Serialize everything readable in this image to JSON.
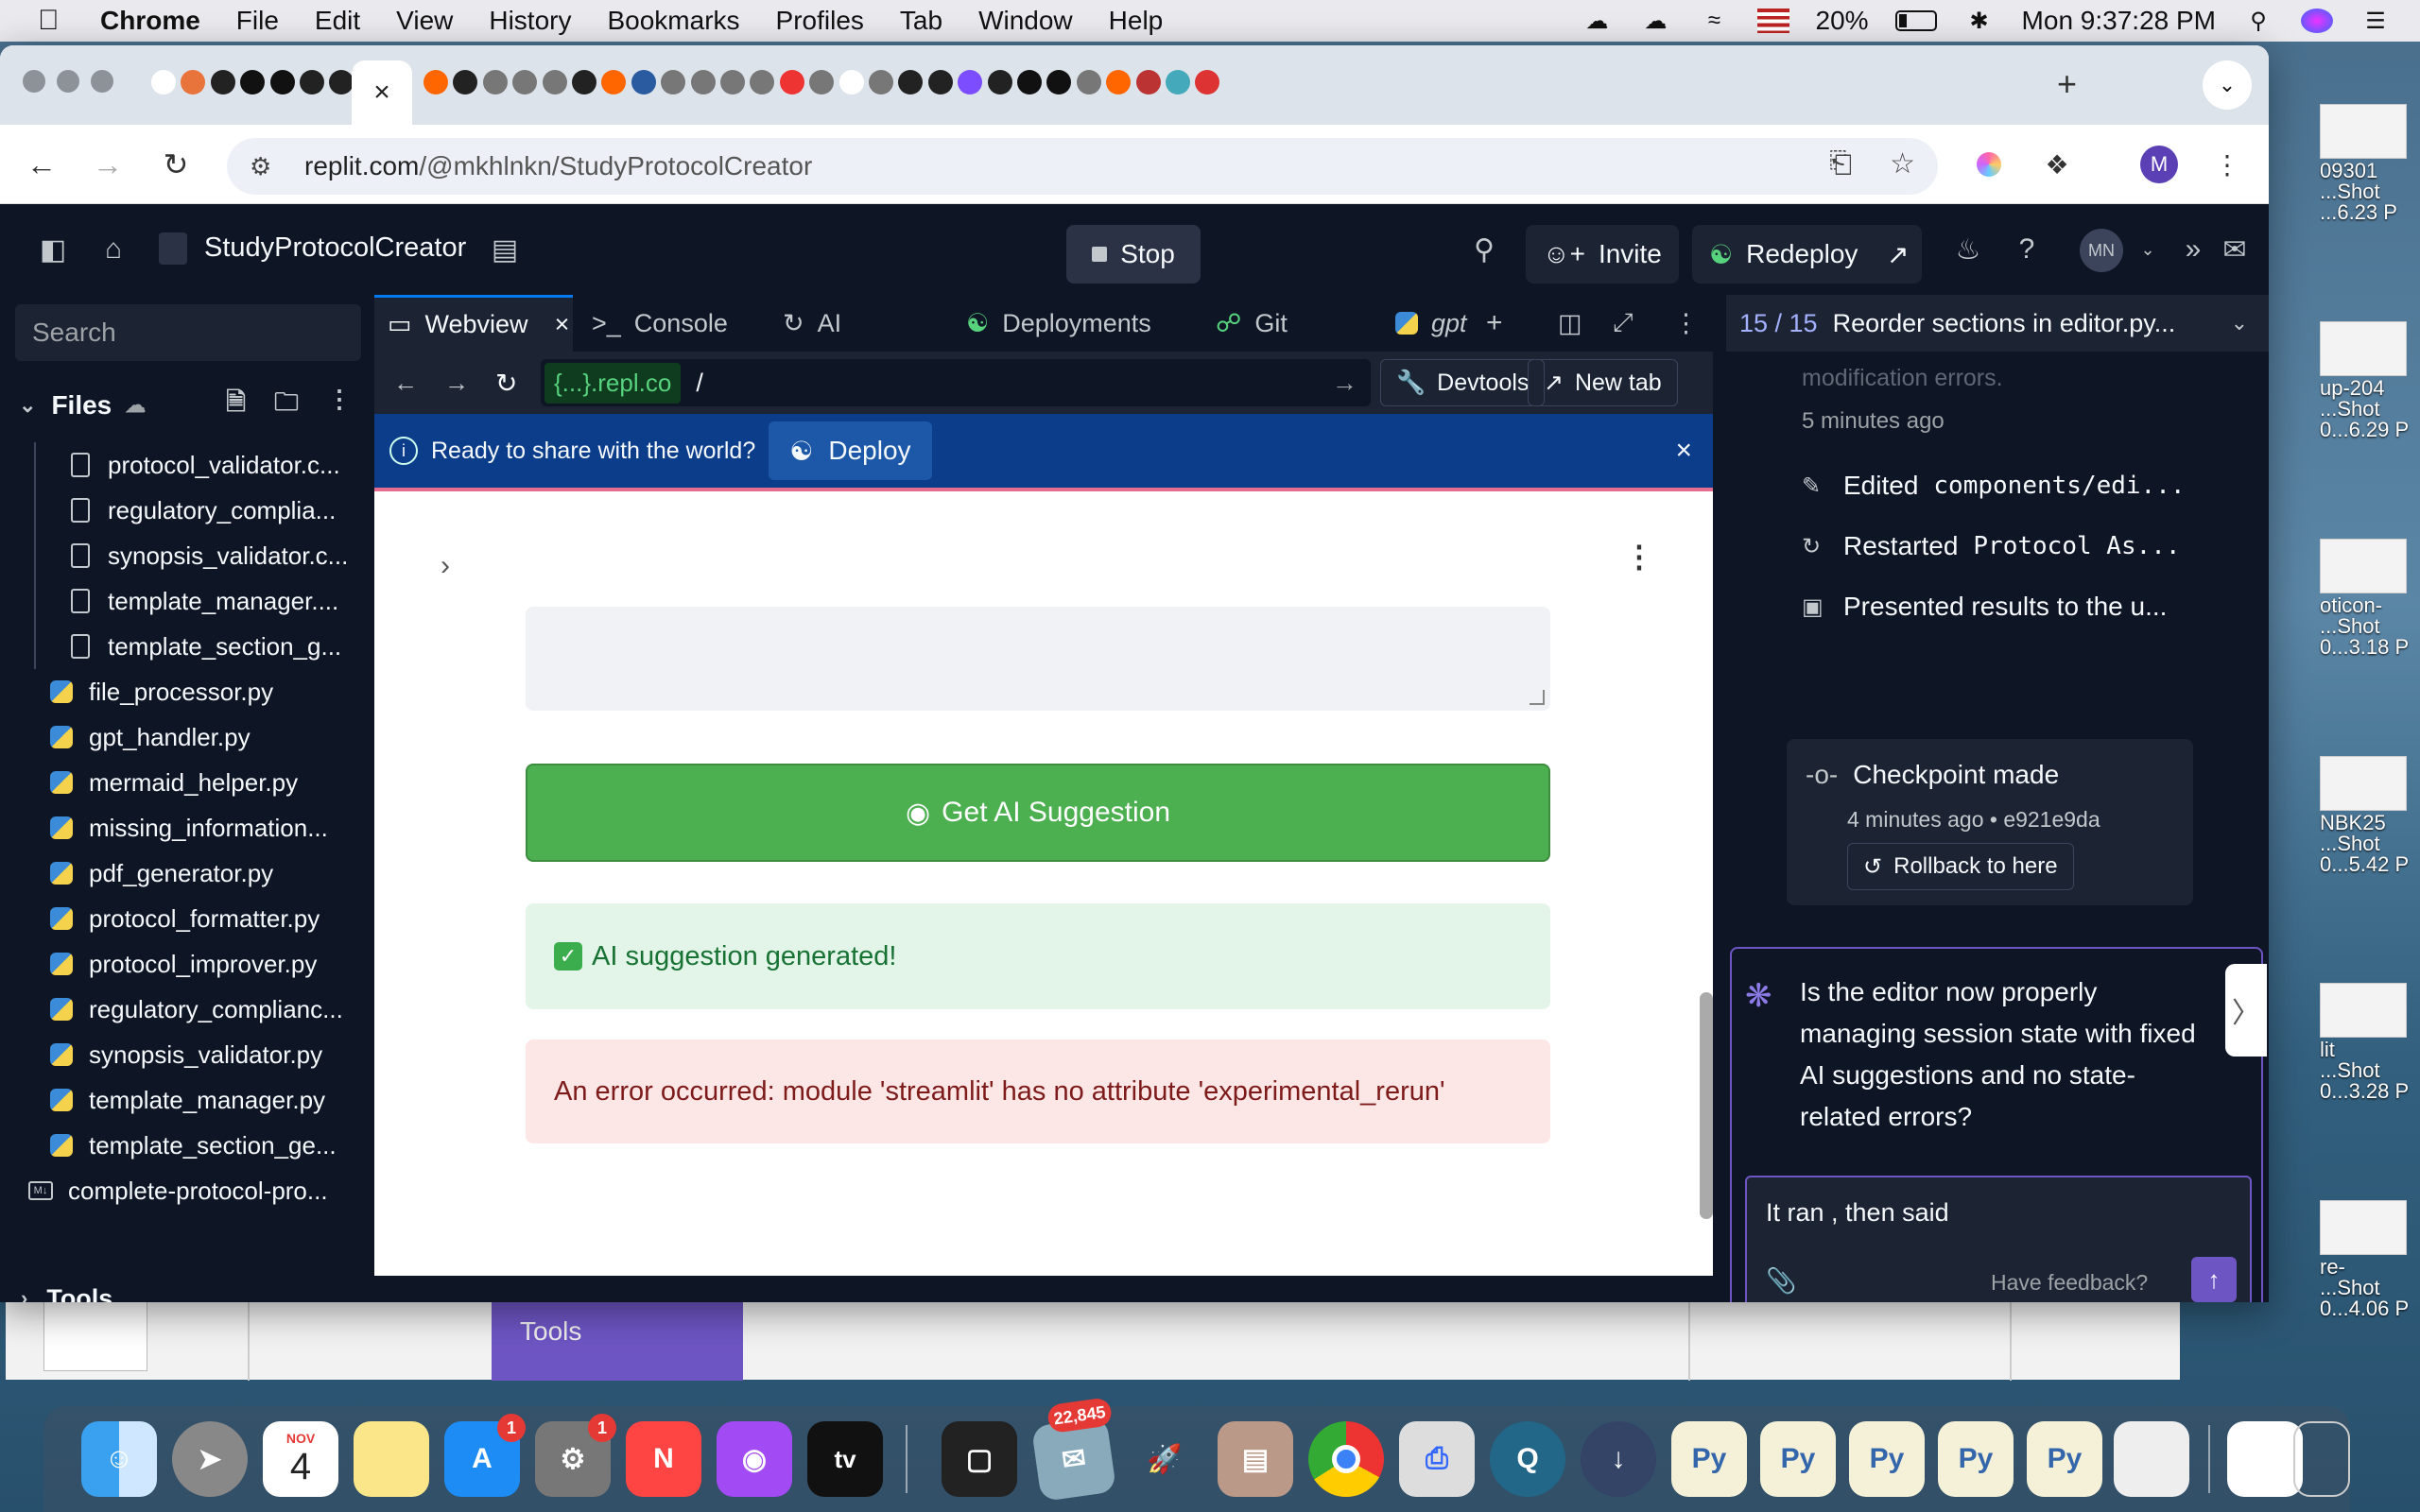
{
  "menubar": {
    "app": "Chrome",
    "items": [
      "File",
      "Edit",
      "View",
      "History",
      "Bookmarks",
      "Profiles",
      "Tab",
      "Window",
      "Help"
    ],
    "battery": "20%",
    "clock": "Mon 9:37:28 PM"
  },
  "chrome": {
    "url_host": "replit.com",
    "url_path": "/@mkhlnkn/StudyProtocolCreator",
    "profile_initial": "M",
    "active_tab_close": "×",
    "new_tab": "+"
  },
  "replit": {
    "project_title": "StudyProtocolCreator",
    "stop_label": "Stop",
    "invite_label": "Invite",
    "redeploy_label": "Redeploy",
    "avatar_initials": "MN",
    "sidebar": {
      "search_placeholder": "Search",
      "files_label": "Files",
      "files": [
        {
          "name": "protocol_validator.c...",
          "type": "doc",
          "indent": 2
        },
        {
          "name": "regulatory_complia...",
          "type": "doc",
          "indent": 2
        },
        {
          "name": "synopsis_validator.c...",
          "type": "doc",
          "indent": 2
        },
        {
          "name": "template_manager....",
          "type": "doc",
          "indent": 2
        },
        {
          "name": "template_section_g...",
          "type": "doc",
          "indent": 2
        },
        {
          "name": "file_processor.py",
          "type": "py",
          "indent": 1
        },
        {
          "name": "gpt_handler.py",
          "type": "py",
          "indent": 1
        },
        {
          "name": "mermaid_helper.py",
          "type": "py",
          "indent": 1
        },
        {
          "name": "missing_information...",
          "type": "py",
          "indent": 1
        },
        {
          "name": "pdf_generator.py",
          "type": "py",
          "indent": 1
        },
        {
          "name": "protocol_formatter.py",
          "type": "py",
          "indent": 1
        },
        {
          "name": "protocol_improver.py",
          "type": "py",
          "indent": 1
        },
        {
          "name": "regulatory_complianc...",
          "type": "py",
          "indent": 1
        },
        {
          "name": "synopsis_validator.py",
          "type": "py",
          "indent": 1
        },
        {
          "name": "template_manager.py",
          "type": "py",
          "indent": 1
        },
        {
          "name": "template_section_ge...",
          "type": "py",
          "indent": 1
        },
        {
          "name": "complete-protocol-pro...",
          "type": "md",
          "indent": 0
        }
      ],
      "tools_label": "Tools"
    },
    "tabs": {
      "webview": "Webview",
      "console": "Console",
      "ai": "AI",
      "deployments": "Deployments",
      "git": "Git",
      "gpt": "gpt"
    },
    "urlbar": {
      "chip": "{...}.repl.co",
      "path": "/",
      "devtools": "Devtools",
      "new_tab": "New tab"
    },
    "banner": {
      "text": "Ready to share with the world?",
      "deploy": "Deploy"
    },
    "webview": {
      "ai_button": "Get AI Suggestion",
      "success": "AI suggestion generated!",
      "error": "An error occurred: module 'streamlit' has no attribute 'experimental_rerun'"
    },
    "agent": {
      "counter": "15 / 15",
      "task_title": "Reorder sections in editor.py...",
      "faded_text": "modification errors.",
      "time_ago": "5 minutes ago",
      "actions": [
        {
          "prefix": "Edited",
          "mono": "components/edi..."
        },
        {
          "prefix": "Restarted",
          "mono": "Protocol As..."
        },
        {
          "prefix": "Presented results to the u...",
          "mono": ""
        }
      ],
      "checkpoint_title": "Checkpoint made",
      "checkpoint_meta": "4 minutes ago • e921e9da",
      "rollback": "Rollback to here",
      "question": "Is the editor now properly managing session state with fixed AI suggestions and no state-related errors?",
      "reply_text": "It ran , then said",
      "feedback": "Have feedback?"
    }
  },
  "backwindow": {
    "tools_label": "Tools"
  },
  "desktop_files": [
    {
      "l1": "09301",
      "l2": "...Shot",
      "l3": "...6.23 P"
    },
    {
      "l1": "up-204",
      "l2": "...Shot",
      "l3": "0...6.29 P"
    },
    {
      "l1": "oticon-",
      "l2": "...Shot",
      "l3": "0...3.18 P"
    },
    {
      "l1": "NBK25",
      "l2": "...Shot",
      "l3": "0...5.42 P"
    },
    {
      "l1": "lit",
      "l2": "...Shot",
      "l3": "0...3.28 P"
    },
    {
      "l1": "re-",
      "l2": "...Shot",
      "l3": "0...4.06 P"
    }
  ],
  "dock": {
    "calendar_month": "NOV",
    "calendar_day": "4",
    "appstore_badge": "1",
    "settings_badge": "1",
    "mail_badge": "22,845",
    "appletv_label": "tv"
  }
}
